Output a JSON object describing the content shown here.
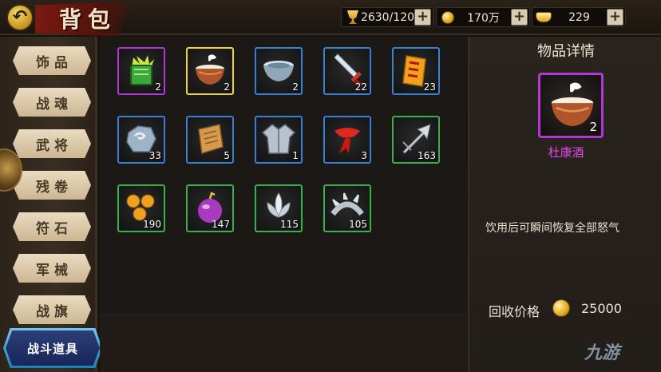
{
  "header": {
    "title": "背包",
    "currencies": [
      {
        "icon": "trophy-icon",
        "value": "2630/120"
      },
      {
        "icon": "coin-icon",
        "value": "170万"
      },
      {
        "icon": "ingot-icon",
        "value": "229"
      }
    ],
    "plus_label": "+"
  },
  "sidebar": {
    "tabs": [
      "饰品",
      "战魂",
      "武将",
      "残卷",
      "符石",
      "军械",
      "战旗"
    ],
    "active_tab": "战斗道具"
  },
  "items": [
    {
      "icon": "green-scroll-flame-icon",
      "count": "2",
      "quality": "purple"
    },
    {
      "icon": "wine-bowl-icon",
      "count": "2",
      "quality": "gold"
    },
    {
      "icon": "empty-bowl-icon",
      "count": "2",
      "quality": "blue"
    },
    {
      "icon": "sword-icon",
      "count": "22",
      "quality": "blue"
    },
    {
      "icon": "talisman-icon",
      "count": "23",
      "quality": "blue"
    },
    {
      "icon": "ore-stone-icon",
      "count": "33",
      "quality": "blue"
    },
    {
      "icon": "parchment-icon",
      "count": "5",
      "quality": "blue"
    },
    {
      "icon": "armor-robe-icon",
      "count": "1",
      "quality": "blue"
    },
    {
      "icon": "red-scarf-icon",
      "count": "3",
      "quality": "blue"
    },
    {
      "icon": "arrowhead-icon",
      "count": "163",
      "quality": "green"
    },
    {
      "icon": "orange-pearls-icon",
      "count": "190",
      "quality": "green"
    },
    {
      "icon": "purple-bomb-icon",
      "count": "147",
      "quality": "green"
    },
    {
      "icon": "silver-lotus-icon",
      "count": "115",
      "quality": "green"
    },
    {
      "icon": "spiked-ring-icon",
      "count": "105",
      "quality": "green"
    }
  ],
  "detail": {
    "title": "物品详情",
    "item_icon": "wine-bowl-icon",
    "item_count": "2",
    "item_name": "杜康酒",
    "description": "饮用后可瞬间恢复全部怒气",
    "price_label": "回收价格",
    "price_value": "25000"
  },
  "watermark": "九游",
  "colors": {
    "purple_quality": "#b436d6",
    "gold_quality": "#f0d430",
    "blue_quality": "#3b7fd4",
    "green_quality": "#36b24a",
    "item_name": "#e04ae0",
    "active_tab": "#1f7fb8"
  }
}
